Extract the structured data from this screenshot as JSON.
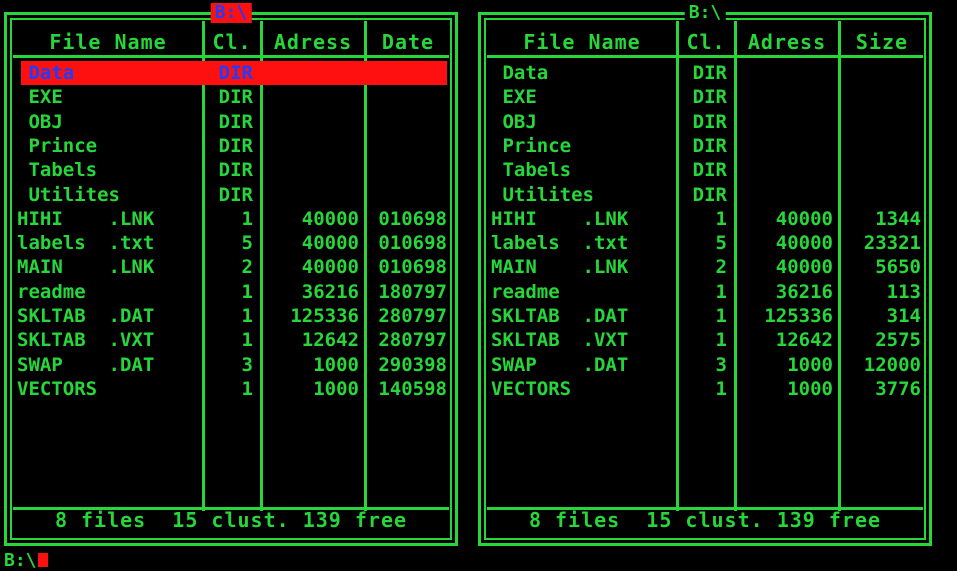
{
  "colors": {
    "fg": "#26d63a",
    "bg": "#000000",
    "highlight": "#ff1010",
    "highlight_text": "#1f3cff"
  },
  "left": {
    "drive": "B:\\",
    "headers": [
      "File Name",
      "Cl.",
      "Adress",
      "Date"
    ],
    "rows": [
      {
        "name": " Data",
        "cl": "DIR",
        "adr": "",
        "last": ""
      },
      {
        "name": " EXE",
        "cl": "DIR",
        "adr": "",
        "last": ""
      },
      {
        "name": " OBJ",
        "cl": "DIR",
        "adr": "",
        "last": ""
      },
      {
        "name": " Prince",
        "cl": "DIR",
        "adr": "",
        "last": ""
      },
      {
        "name": " Tabels",
        "cl": "DIR",
        "adr": "",
        "last": ""
      },
      {
        "name": " Utilites",
        "cl": "DIR",
        "adr": "",
        "last": ""
      },
      {
        "name": "HIHI    .LNK",
        "cl": "1",
        "adr": "40000",
        "last": "010698"
      },
      {
        "name": "labels  .txt",
        "cl": "5",
        "adr": "40000",
        "last": "010698"
      },
      {
        "name": "MAIN    .LNK",
        "cl": "2",
        "adr": "40000",
        "last": "010698"
      },
      {
        "name": "readme",
        "cl": "1",
        "adr": "36216",
        "last": "180797"
      },
      {
        "name": "SKLTAB  .DAT",
        "cl": "1",
        "adr": "125336",
        "last": "280797"
      },
      {
        "name": "SKLTAB  .VXT",
        "cl": "1",
        "adr": "12642",
        "last": "280797"
      },
      {
        "name": "SWAP    .DAT",
        "cl": "3",
        "adr": "1000",
        "last": "290398"
      },
      {
        "name": "VECTORS",
        "cl": "1",
        "adr": "1000",
        "last": "140598"
      }
    ],
    "footer": "8 files  15 clust. 139 free"
  },
  "right": {
    "drive": "B:\\",
    "headers": [
      "File Name",
      "Cl.",
      "Adress",
      "Size"
    ],
    "rows": [
      {
        "name": " Data",
        "cl": "DIR",
        "adr": "",
        "last": ""
      },
      {
        "name": " EXE",
        "cl": "DIR",
        "adr": "",
        "last": ""
      },
      {
        "name": " OBJ",
        "cl": "DIR",
        "adr": "",
        "last": ""
      },
      {
        "name": " Prince",
        "cl": "DIR",
        "adr": "",
        "last": ""
      },
      {
        "name": " Tabels",
        "cl": "DIR",
        "adr": "",
        "last": ""
      },
      {
        "name": " Utilites",
        "cl": "DIR",
        "adr": "",
        "last": ""
      },
      {
        "name": "HIHI    .LNK",
        "cl": "1",
        "adr": "40000",
        "last": "1344"
      },
      {
        "name": "labels  .txt",
        "cl": "5",
        "adr": "40000",
        "last": "23321"
      },
      {
        "name": "MAIN    .LNK",
        "cl": "2",
        "adr": "40000",
        "last": "5650"
      },
      {
        "name": "readme",
        "cl": "1",
        "adr": "36216",
        "last": "113"
      },
      {
        "name": "SKLTAB  .DAT",
        "cl": "1",
        "adr": "125336",
        "last": "314"
      },
      {
        "name": "SKLTAB  .VXT",
        "cl": "1",
        "adr": "12642",
        "last": "2575"
      },
      {
        "name": "SWAP    .DAT",
        "cl": "3",
        "adr": "1000",
        "last": "12000"
      },
      {
        "name": "VECTORS",
        "cl": "1",
        "adr": "1000",
        "last": "3776"
      }
    ],
    "footer": "8 files  15 clust. 139 free"
  },
  "prompt": "B:\\"
}
